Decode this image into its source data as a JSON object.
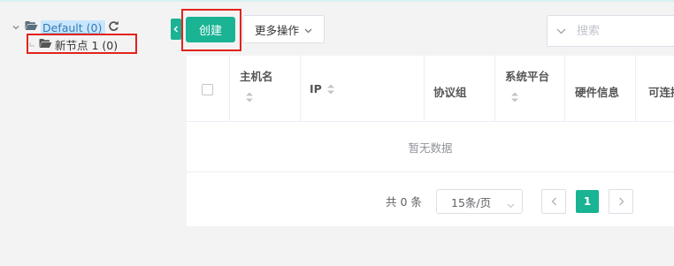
{
  "tree": {
    "root": {
      "label": "Default (0)"
    },
    "child": {
      "label": "新节点 1 (0)"
    }
  },
  "toolbar": {
    "create_label": "创建",
    "more_actions_label": "更多操作",
    "search_placeholder": "搜索"
  },
  "table": {
    "columns": [
      "主机名",
      "IP",
      "协议组",
      "系统平台",
      "硬件信息",
      "可连接"
    ],
    "empty_text": "暂无数据"
  },
  "pagination": {
    "total_text": "共 0 条",
    "page_size": "15条/页",
    "current_page": "1"
  },
  "colors": {
    "accent": "#1ab394",
    "highlight_box": "#e2231a",
    "tree_selected_bg": "#c9e6fc"
  }
}
